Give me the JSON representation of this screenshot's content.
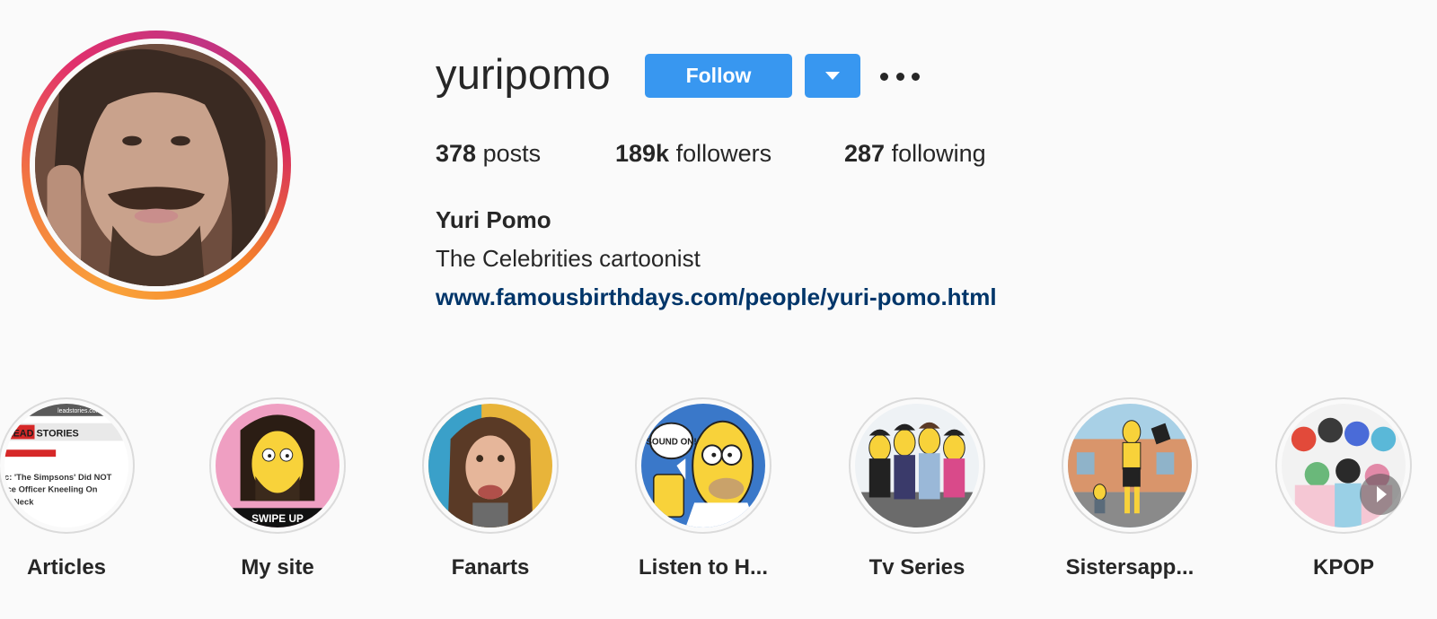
{
  "profile": {
    "username": "yuripomo",
    "follow_label": "Follow",
    "full_name": "Yuri Pomo",
    "bio": "The Celebrities cartoonist",
    "link": "www.famousbirthdays.com/people/yuri-pomo.html"
  },
  "stats": {
    "posts_count": "378",
    "posts_label": " posts",
    "followers_count": "189k",
    "followers_label": " followers",
    "following_count": "287",
    "following_label": " following"
  },
  "highlights": [
    {
      "label": "Articles"
    },
    {
      "label": "My site"
    },
    {
      "label": "Fanarts"
    },
    {
      "label": "Listen to H..."
    },
    {
      "label": "Tv Series"
    },
    {
      "label": "Sistersapp..."
    },
    {
      "label": "KPOP"
    }
  ],
  "highlight_art": {
    "articles_header": "LEAD STORIES",
    "articles_site": "leadstories.com",
    "articles_lines": [
      "c: 'The Simpsons' Did NOT",
      "ice Officer Kneeling On",
      "'s Neck"
    ],
    "mysite_caption": "SWIPE UP",
    "listen_bubble": "SOUND ON!"
  },
  "icons": {
    "more": "more-options-icon",
    "dropdown": "chevron-down-icon",
    "next": "next-arrow-icon"
  },
  "colors": {
    "primary_button": "#3897f0",
    "link": "#003569",
    "background": "#fafafa"
  }
}
